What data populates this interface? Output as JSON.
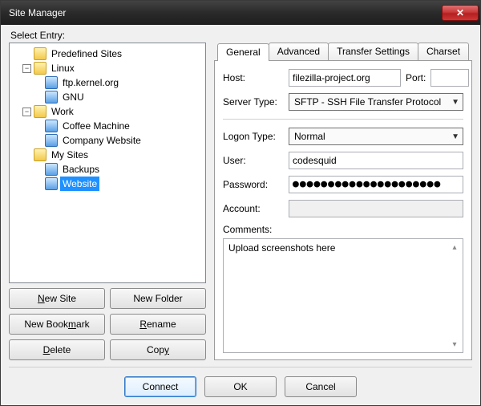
{
  "window": {
    "title": "Site Manager"
  },
  "select_entry_label": "Select Entry:",
  "tree": {
    "predefined_label": "Predefined Sites",
    "linux": {
      "label": "Linux",
      "kernel": "ftp.kernel.org",
      "gnu": "GNU"
    },
    "work": {
      "label": "Work",
      "coffee": "Coffee Machine",
      "company": "Company Website"
    },
    "mysites": {
      "label": "My Sites",
      "backups": "Backups",
      "website": "Website"
    }
  },
  "left_buttons": {
    "new_site": "New Site",
    "new_folder": "New Folder",
    "new_bookmark": "New Bookmark",
    "rename": "Rename",
    "delete": "Delete",
    "copy": "Copy"
  },
  "tabs": {
    "general": "General",
    "advanced": "Advanced",
    "transfer": "Transfer Settings",
    "charset": "Charset"
  },
  "form": {
    "host_label": "Host:",
    "host_value": "filezilla-project.org",
    "port_label": "Port:",
    "port_value": "",
    "server_type_label": "Server Type:",
    "server_type_value": "SFTP - SSH File Transfer Protocol",
    "logon_type_label": "Logon Type:",
    "logon_type_value": "Normal",
    "user_label": "User:",
    "user_value": "codesquid",
    "password_label": "Password:",
    "password_value": "●●●●●●●●●●●●●●●●●●●●●",
    "account_label": "Account:",
    "account_value": "",
    "comments_label": "Comments:",
    "comments_value": "Upload screenshots here"
  },
  "footer": {
    "connect": "Connect",
    "ok": "OK",
    "cancel": "Cancel"
  }
}
